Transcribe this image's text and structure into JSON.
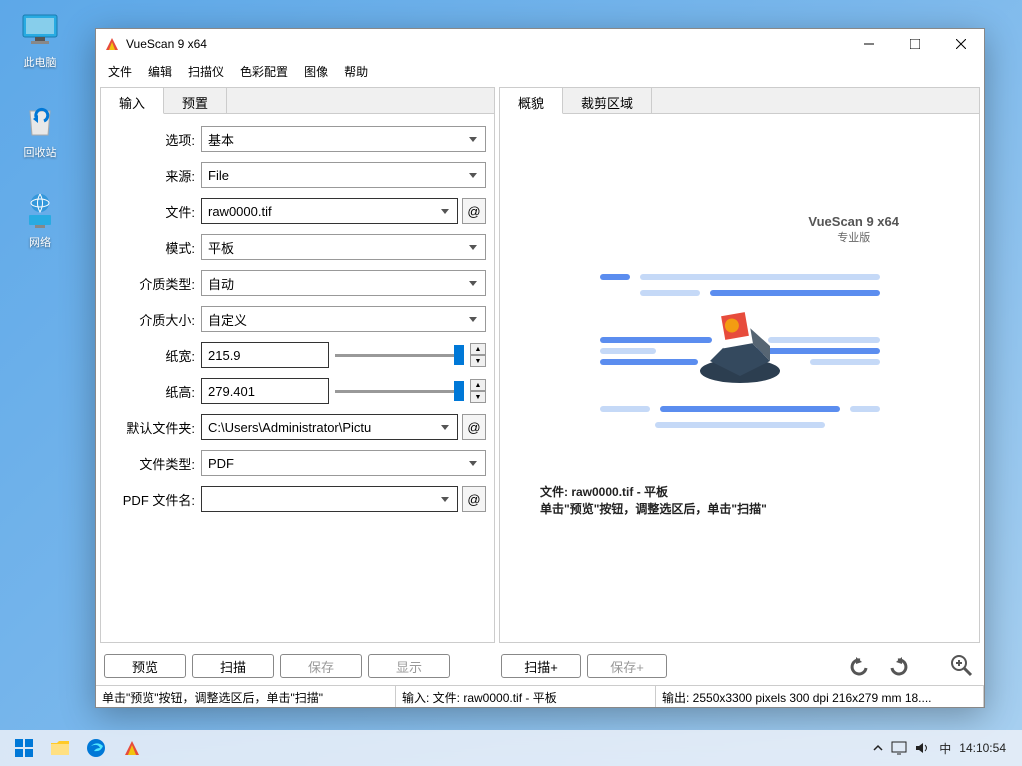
{
  "desktop": {
    "icons": [
      {
        "label": "此电脑"
      },
      {
        "label": "回收站"
      },
      {
        "label": "网络"
      }
    ]
  },
  "window": {
    "title": "VueScan 9 x64",
    "menu": [
      "文件",
      "编辑",
      "扫描仪",
      "色彩配置",
      "图像",
      "帮助"
    ],
    "left": {
      "tabs": [
        "输入",
        "预置"
      ],
      "active": 0,
      "fields": {
        "options_label": "选项:",
        "options_value": "基本",
        "source_label": "来源:",
        "source_value": "File",
        "file_label": "文件:",
        "file_value": "raw0000.tif",
        "mode_label": "模式:",
        "mode_value": "平板",
        "media_type_label": "介质类型:",
        "media_type_value": "自动",
        "media_size_label": "介质大小:",
        "media_size_value": "自定义",
        "paper_w_label": "纸宽:",
        "paper_w_value": "215.9",
        "paper_h_label": "纸高:",
        "paper_h_value": "279.401",
        "default_folder_label": "默认文件夹:",
        "default_folder_value": "C:\\Users\\Administrator\\Pictu",
        "file_type_label": "文件类型:",
        "file_type_value": "PDF",
        "pdf_name_label": "PDF 文件名:",
        "pdf_name_value": ""
      }
    },
    "right": {
      "tabs": [
        "概貌",
        "裁剪区域"
      ],
      "active": 0,
      "brand_title": "VueScan 9 x64",
      "brand_sub": "专业版",
      "hint_line1": "文件: raw0000.tif - 平板",
      "hint_line2": "单击\"预览\"按钮，调整选区后，单击\"扫描\""
    },
    "buttons": {
      "preview": "预览",
      "scan": "扫描",
      "save": "保存",
      "show": "显示",
      "scan_plus": "扫描+",
      "save_plus": "保存+"
    },
    "status": {
      "seg1": "单击\"预览\"按钮，调整选区后，单击\"扫描\"",
      "seg2": "输入: 文件: raw0000.tif - 平板",
      "seg3": "输出: 2550x3300 pixels 300 dpi 216x279 mm 18...."
    }
  },
  "tray": {
    "ime": "中",
    "time": "14:10:54"
  },
  "at": "@"
}
